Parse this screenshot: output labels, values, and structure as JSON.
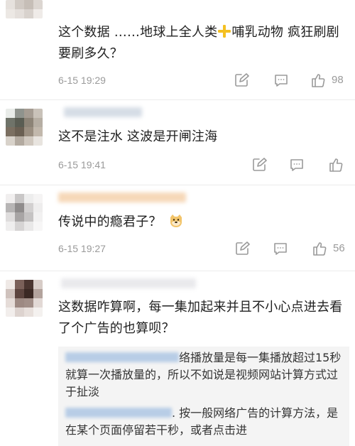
{
  "comments": [
    {
      "text_a": "这个数据 ……地球上全人类",
      "text_b": "哺乳动物  疯狂刷剧要刷多久？",
      "time": "6-15 19:29",
      "likes": "98",
      "icons": [
        "share-icon",
        "comment-icon",
        "thumbs-up-icon"
      ]
    },
    {
      "text": "这不是注水  这波是开闸注海",
      "time": "6-15 19:41",
      "likes": "",
      "icons": [
        "share-icon",
        "comment-icon",
        "thumbs-up-icon"
      ]
    },
    {
      "text": "传说中的瘾君子？",
      "time": "6-15 19:27",
      "likes": "56",
      "icons": [
        "share-icon",
        "comment-icon",
        "thumbs-up-icon",
        "doge-emoji"
      ]
    },
    {
      "text": "这数据咋算啊，每一集加起来并且不小心点进去看了个广告的也算呗？"
    }
  ],
  "replies": [
    {
      "text": "络播放量是每一集播放超过15秒就算一次播放量的，所以不如说是视频网站计算方式过于扯淡"
    },
    {
      "text": ". 按一般网络广告的计算方法，是在某个页面停留若干秒，或者点击进"
    }
  ],
  "colors": {
    "time": "#9a9a9a",
    "reply_bg": "#f4f4f4",
    "username_blur": "#b8cde6"
  }
}
